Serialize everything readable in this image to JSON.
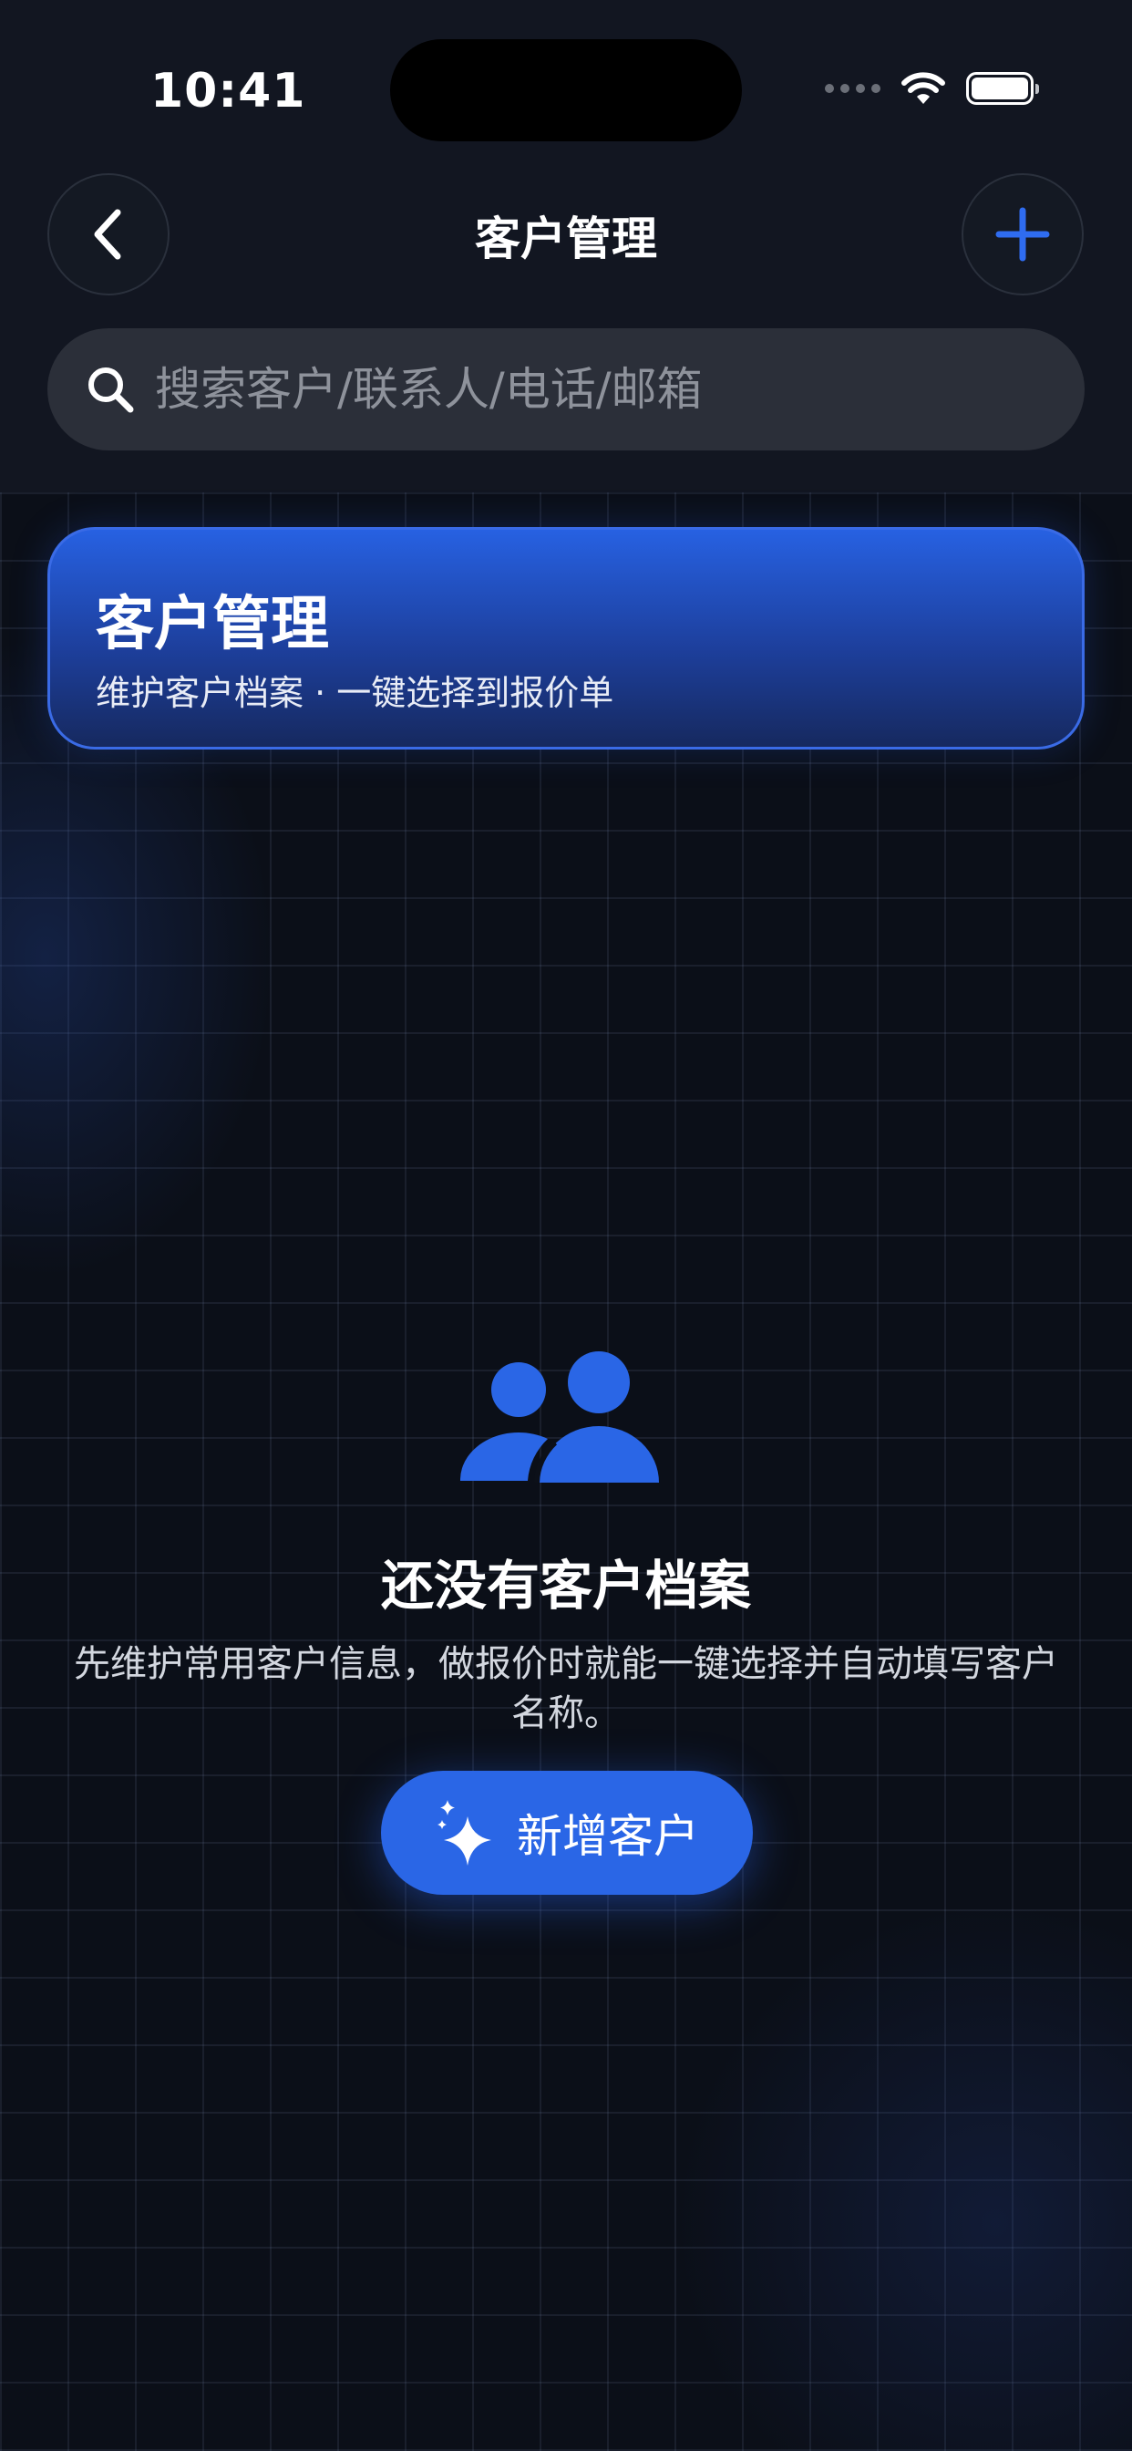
{
  "status_bar": {
    "time": "10:41"
  },
  "nav": {
    "title": "客户管理",
    "back_icon": "chevron-left-icon",
    "add_icon": "plus-icon"
  },
  "search": {
    "placeholder": "搜索客户/联系人/电话/邮箱",
    "value": ""
  },
  "banner": {
    "title": "客户管理",
    "subtitle": "维护客户档案 · 一键选择到报价单"
  },
  "empty_state": {
    "icon": "users-icon",
    "title": "还没有客户档案",
    "description": "先维护常用客户信息，做报价时就能一键选择并自动填写客户名称。",
    "button_label": "新增客户",
    "button_icon": "sparkles-icon"
  },
  "colors": {
    "accent": "#2a66e6",
    "background": "#0c1019",
    "header": "#121621",
    "search_bg": "#2b2f39"
  }
}
